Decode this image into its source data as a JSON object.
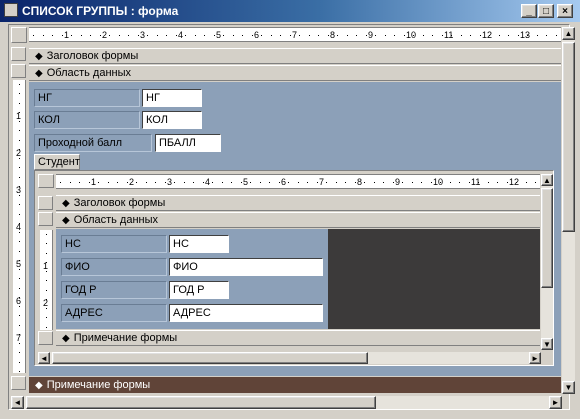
{
  "window": {
    "title": "СПИСОК ГРУППЫ : форма",
    "min": "_",
    "max": "□",
    "close": "×"
  },
  "ruler_numbers": [
    "1",
    "2",
    "3",
    "4",
    "5",
    "6",
    "7",
    "8",
    "9",
    "10",
    "11",
    "12",
    "13"
  ],
  "vruler_numbers": [
    "1",
    "2",
    "3",
    "4",
    "5",
    "6",
    "7"
  ],
  "sections": {
    "header": "Заголовок формы",
    "detail": "Область данных",
    "footer": "Примечание формы"
  },
  "fields": [
    {
      "label": "НГ",
      "value": "НГ"
    },
    {
      "label": "КОЛ",
      "value": "КОЛ"
    },
    {
      "label": "Проходной балл",
      "value": "ПБАЛЛ"
    }
  ],
  "subform_label": "Студент",
  "subform": {
    "ruler_numbers": [
      "1",
      "2",
      "3",
      "4",
      "5",
      "6",
      "7",
      "8",
      "9",
      "10",
      "11",
      "12"
    ],
    "vruler_numbers": [
      "1",
      "2"
    ],
    "sections": {
      "header": "Заголовок формы",
      "detail": "Область данных",
      "footer": "Примечание формы"
    },
    "fields": [
      {
        "label": "НС",
        "value": "НС"
      },
      {
        "label": "ФИО",
        "value": "ФИО"
      },
      {
        "label": "ГОД Р",
        "value": "ГОД Р"
      },
      {
        "label": "АДРЕС",
        "value": "АДРЕС"
      }
    ]
  },
  "colors": {
    "detail": "#8ca0b8",
    "footer": "#604438",
    "dark": "#3c3a3a"
  }
}
